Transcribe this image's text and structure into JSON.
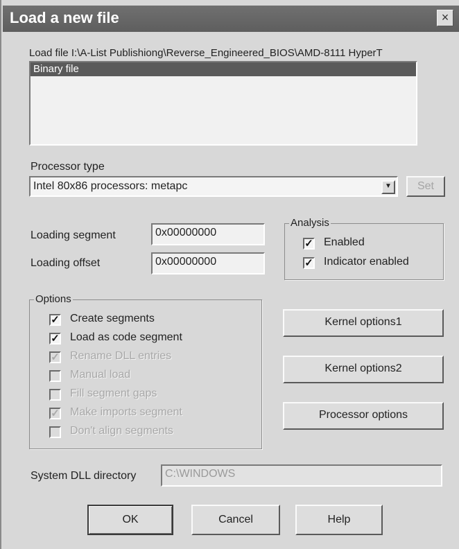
{
  "dialog": {
    "title": "Load a new file",
    "close_glyph": "×",
    "load_file_text": "Load file I:\\A-List Publishiong\\Reverse_Engineered_BIOS\\AMD-8111 HyperT",
    "file_types": {
      "items": [
        "Binary file"
      ]
    },
    "processor": {
      "label": "Processor type",
      "selected": "Intel 80x86 processors: metapc",
      "set_button": "Set"
    },
    "loading": {
      "segment_label": "Loading segment",
      "segment_value": "0x00000000",
      "offset_label": "Loading offset",
      "offset_value": "0x00000000"
    },
    "analysis": {
      "title": "Analysis",
      "enabled_label": "Enabled",
      "indicator_label": "Indicator enabled"
    },
    "options": {
      "title": "Options",
      "items": [
        {
          "label": "Create segments",
          "checked": true,
          "enabled": true
        },
        {
          "label": "Load as code segment",
          "checked": true,
          "enabled": true
        },
        {
          "label": "Rename DLL entries",
          "checked": true,
          "enabled": false
        },
        {
          "label": "Manual load",
          "checked": false,
          "enabled": false
        },
        {
          "label": "Fill segment gaps",
          "checked": false,
          "enabled": false
        },
        {
          "label": "Make imports segment",
          "checked": true,
          "enabled": false
        },
        {
          "label": "Don't align segments",
          "checked": false,
          "enabled": false
        }
      ]
    },
    "buttons": {
      "kernel1": "Kernel options1",
      "kernel2": "Kernel options2",
      "processor_options": "Processor options",
      "ok": "OK",
      "cancel": "Cancel",
      "help": "Help"
    },
    "dll": {
      "label": "System DLL directory",
      "value": "C:\\WINDOWS"
    },
    "check_glyph": "✓"
  }
}
